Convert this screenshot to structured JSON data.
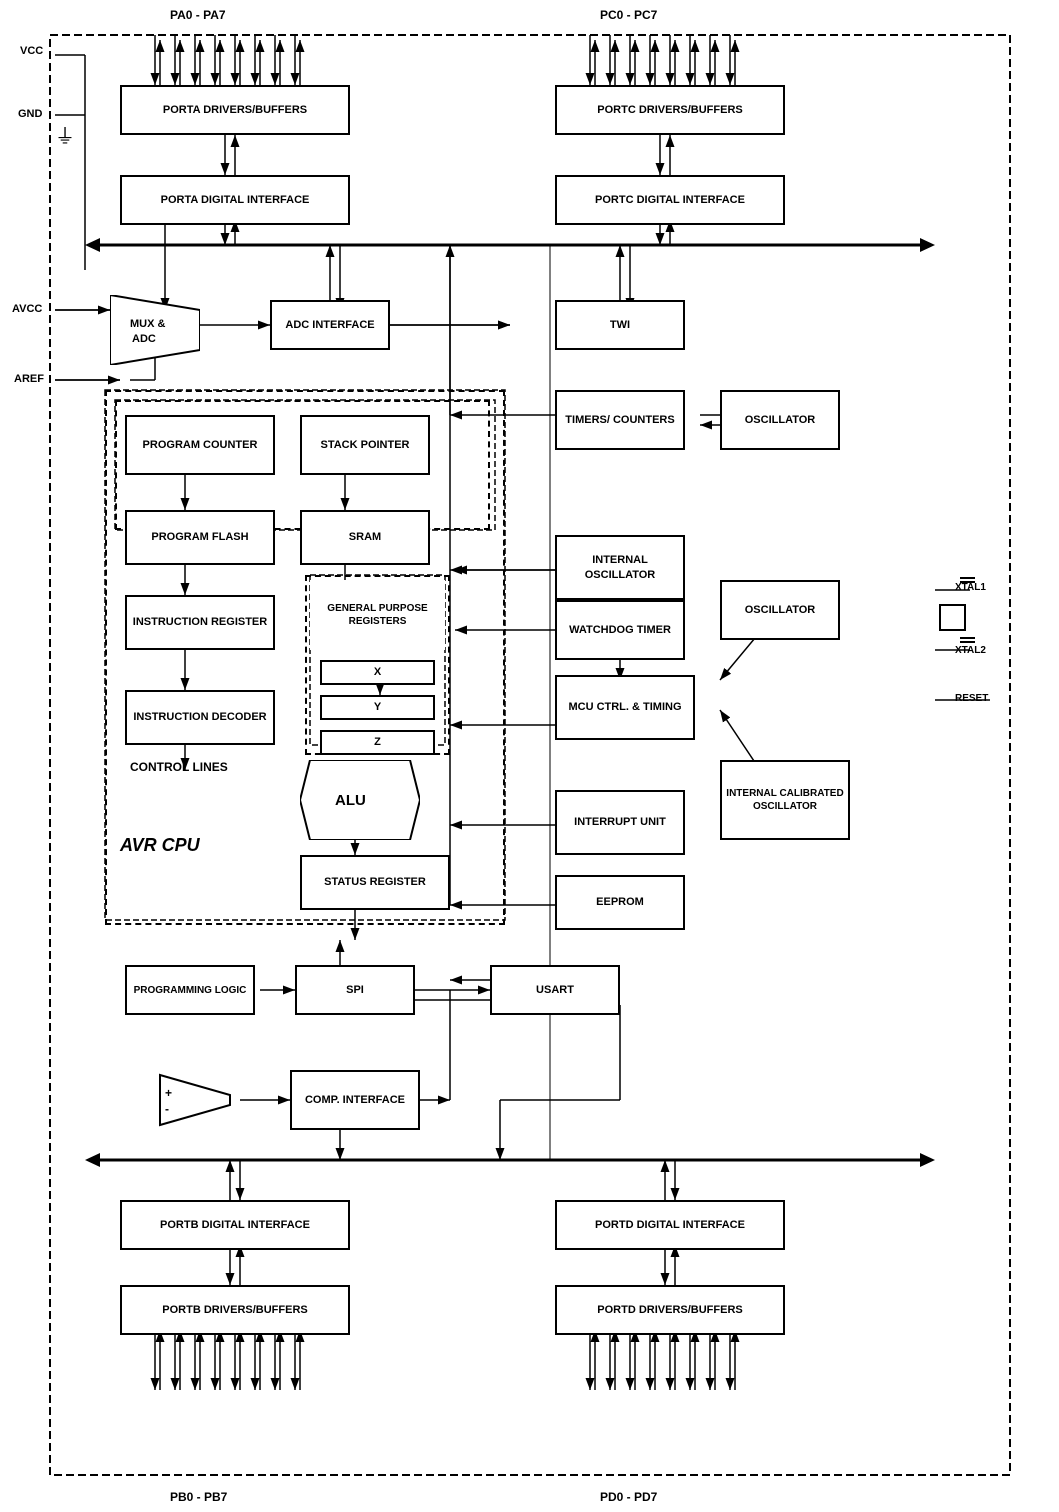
{
  "blocks": {
    "porta_drivers": "PORTA DRIVERS/BUFFERS",
    "porta_digital": "PORTA DIGITAL INTERFACE",
    "portc_drivers": "PORTC DRIVERS/BUFFERS",
    "portc_digital": "PORTC DIGITAL INTERFACE",
    "portb_digital": "PORTB DIGITAL INTERFACE",
    "portb_drivers": "PORTB DRIVERS/BUFFERS",
    "portd_digital": "PORTD DIGITAL INTERFACE",
    "portd_drivers": "PORTD DRIVERS/BUFFERS",
    "adc_interface": "ADC INTERFACE",
    "twi": "TWI",
    "timers_counters": "TIMERS/ COUNTERS",
    "oscillator_top": "OSCILLATOR",
    "internal_osc": "INTERNAL OSCILLATOR",
    "watchdog": "WATCHDOG TIMER",
    "oscillator_mid": "OSCILLATOR",
    "mcu_ctrl": "MCU CTRL. & TIMING",
    "interrupt_unit": "INTERRUPT UNIT",
    "internal_cal_osc": "INTERNAL CALIBRATED OSCILLATOR",
    "eeprom": "EEPROM",
    "usart": "USART",
    "spi": "SPI",
    "programming_logic": "PROGRAMMING LOGIC",
    "comp_interface": "COMP. INTERFACE",
    "program_counter": "PROGRAM COUNTER",
    "stack_pointer": "STACK POINTER",
    "program_flash": "PROGRAM FLASH",
    "sram": "SRAM",
    "instruction_register": "INSTRUCTION REGISTER",
    "instruction_decoder": "INSTRUCTION DECODER",
    "general_purpose_regs": "GENERAL PURPOSE REGISTERS",
    "reg_x": "X",
    "reg_y": "Y",
    "reg_z": "Z",
    "status_register": "STATUS REGISTER",
    "alu": "ALU",
    "mux_adc": "MUX & ADC",
    "avr_cpu": "AVR CPU",
    "control_lines": "CONTROL LINES"
  },
  "pins": {
    "pa0_pa7": "PA0 - PA7",
    "pc0_pc7": "PC0 - PC7",
    "pb0_pb7": "PB0 - PB7",
    "pd0_pd7": "PD0 - PD7",
    "vcc": "VCC",
    "gnd": "GND",
    "avcc": "AVCC",
    "aref": "AREF",
    "xtal1": "XTAL1",
    "xtal2": "XTAL2",
    "reset": "RESET"
  },
  "colors": {
    "border": "#000000",
    "bg": "#ffffff",
    "dashed": "#000000"
  }
}
